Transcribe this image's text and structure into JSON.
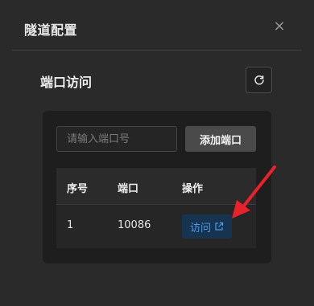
{
  "dialog": {
    "title": "隧道配置",
    "close_glyph": "×",
    "close_icon": "close-icon"
  },
  "section": {
    "title": "端口访问",
    "refresh_icon": "refresh-icon"
  },
  "form": {
    "port_placeholder": "请输入端口号",
    "port_value": "",
    "add_label": "添加端口"
  },
  "table": {
    "columns": [
      "序号",
      "端口",
      "操作"
    ],
    "rows": [
      {
        "index": "1",
        "port": "10086",
        "action_label": "访问",
        "action_icon": "external-link-icon"
      }
    ]
  },
  "colors": {
    "background": "#2a2a2a",
    "card": "#1e1e1e",
    "accent": "#4c9be8",
    "annotation_arrow": "#e8222b"
  }
}
